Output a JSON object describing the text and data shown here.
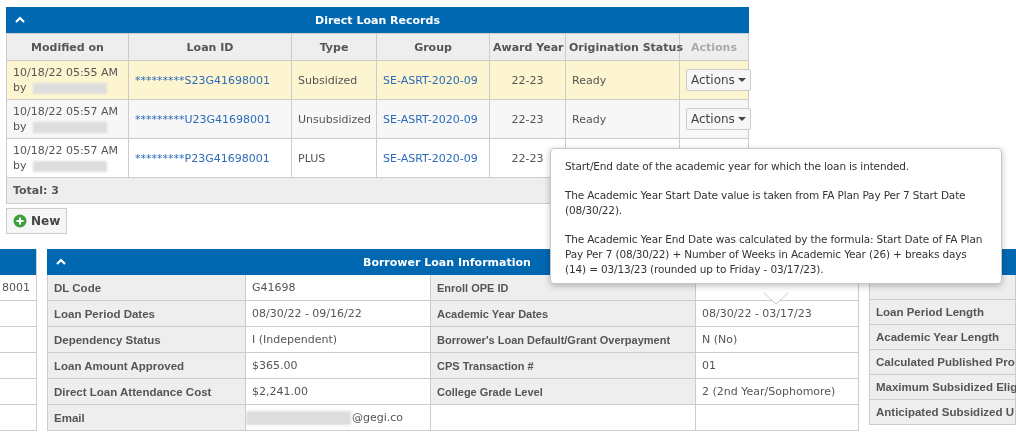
{
  "loan_records": {
    "title": "Direct Loan Records",
    "columns": [
      {
        "label": "Modified on",
        "disabled": false
      },
      {
        "label": "Loan ID",
        "disabled": false
      },
      {
        "label": "Type",
        "disabled": false
      },
      {
        "label": "Group",
        "disabled": false
      },
      {
        "label": "Award Year",
        "disabled": false
      },
      {
        "label": "Origination Status",
        "disabled": false
      },
      {
        "label": "Actions",
        "disabled": true
      }
    ],
    "rows": [
      {
        "modified": "10/18/22 05:55 AM",
        "by": "by",
        "name_hidden": true,
        "loan_id": "*********S23G41698001",
        "type": "Subsidized",
        "group": "SE-ASRT-2020-09",
        "award_year": "22-23",
        "status": "Ready",
        "action": "Actions",
        "selected": true
      },
      {
        "modified": "10/18/22 05:57 AM",
        "by": "by",
        "name_hidden": true,
        "loan_id": "*********U23G41698001",
        "type": "Unsubsidized",
        "group": "SE-ASRT-2020-09",
        "award_year": "22-23",
        "status": "Ready",
        "action": "Actions",
        "selected": false
      },
      {
        "modified": "10/18/22 05:57 AM",
        "by": "by",
        "name_hidden": true,
        "loan_id": "*********P23G41698001",
        "type": "PLUS",
        "group": "SE-ASRT-2020-09",
        "award_year": "22-23",
        "selected": false
      }
    ],
    "total": "Total: 3"
  },
  "new_button": {
    "label": "New"
  },
  "left_panel": {
    "rows": [
      "8001",
      "",
      "",
      "",
      "",
      ""
    ]
  },
  "borrower_info": {
    "title": "Borrower Loan Information",
    "rows": [
      {
        "label": "DL Code",
        "value": "G41698",
        "label_2": "Enroll OPE ID"
      },
      {
        "label": "Loan Period Dates",
        "value": "08/30/22 - 09/16/22",
        "label_2": "Academic Year Dates",
        "value_2": "08/30/22 - 03/17/23"
      },
      {
        "label": "Dependency Status",
        "value": "I (Independent)",
        "label_2": "Borrower's Loan Default/Grant Overpayment",
        "value_2": "N (No)"
      },
      {
        "label": "Loan Amount Approved",
        "value": "$365.00",
        "label_2": "CPS Transaction #",
        "value_2": "01"
      },
      {
        "label": "Direct Loan Attendance Cost",
        "value": "$2,241.00",
        "label_2": "College Grade Level",
        "value_2": "2 (2nd Year/Sophomore)"
      },
      {
        "label": "Email",
        "value": "@gegi.co",
        "value_hidden_part": true
      }
    ]
  },
  "right_panel": {
    "rows": [
      "",
      "Loan Period Length",
      "Academic Year Length",
      "Calculated Published Pro",
      "Maximum Subsidized Elig",
      "Anticipated Subsidized U"
    ]
  },
  "tooltip": {
    "paragraphs": [
      "Start/End date of the academic year for which the loan is intended.",
      "The Academic Year Start Date value is taken from FA Plan Pay Per 7 Start Date (08/30/22).",
      "The Academic Year End Date was calculated by the formula: Start Date of FA Plan Pay Per 7 (08/30/22) + Number of Weeks in Academic Year (26) + breaks days (14) = 03/13/23 (rounded up to Friday - 03/17/23)."
    ]
  }
}
